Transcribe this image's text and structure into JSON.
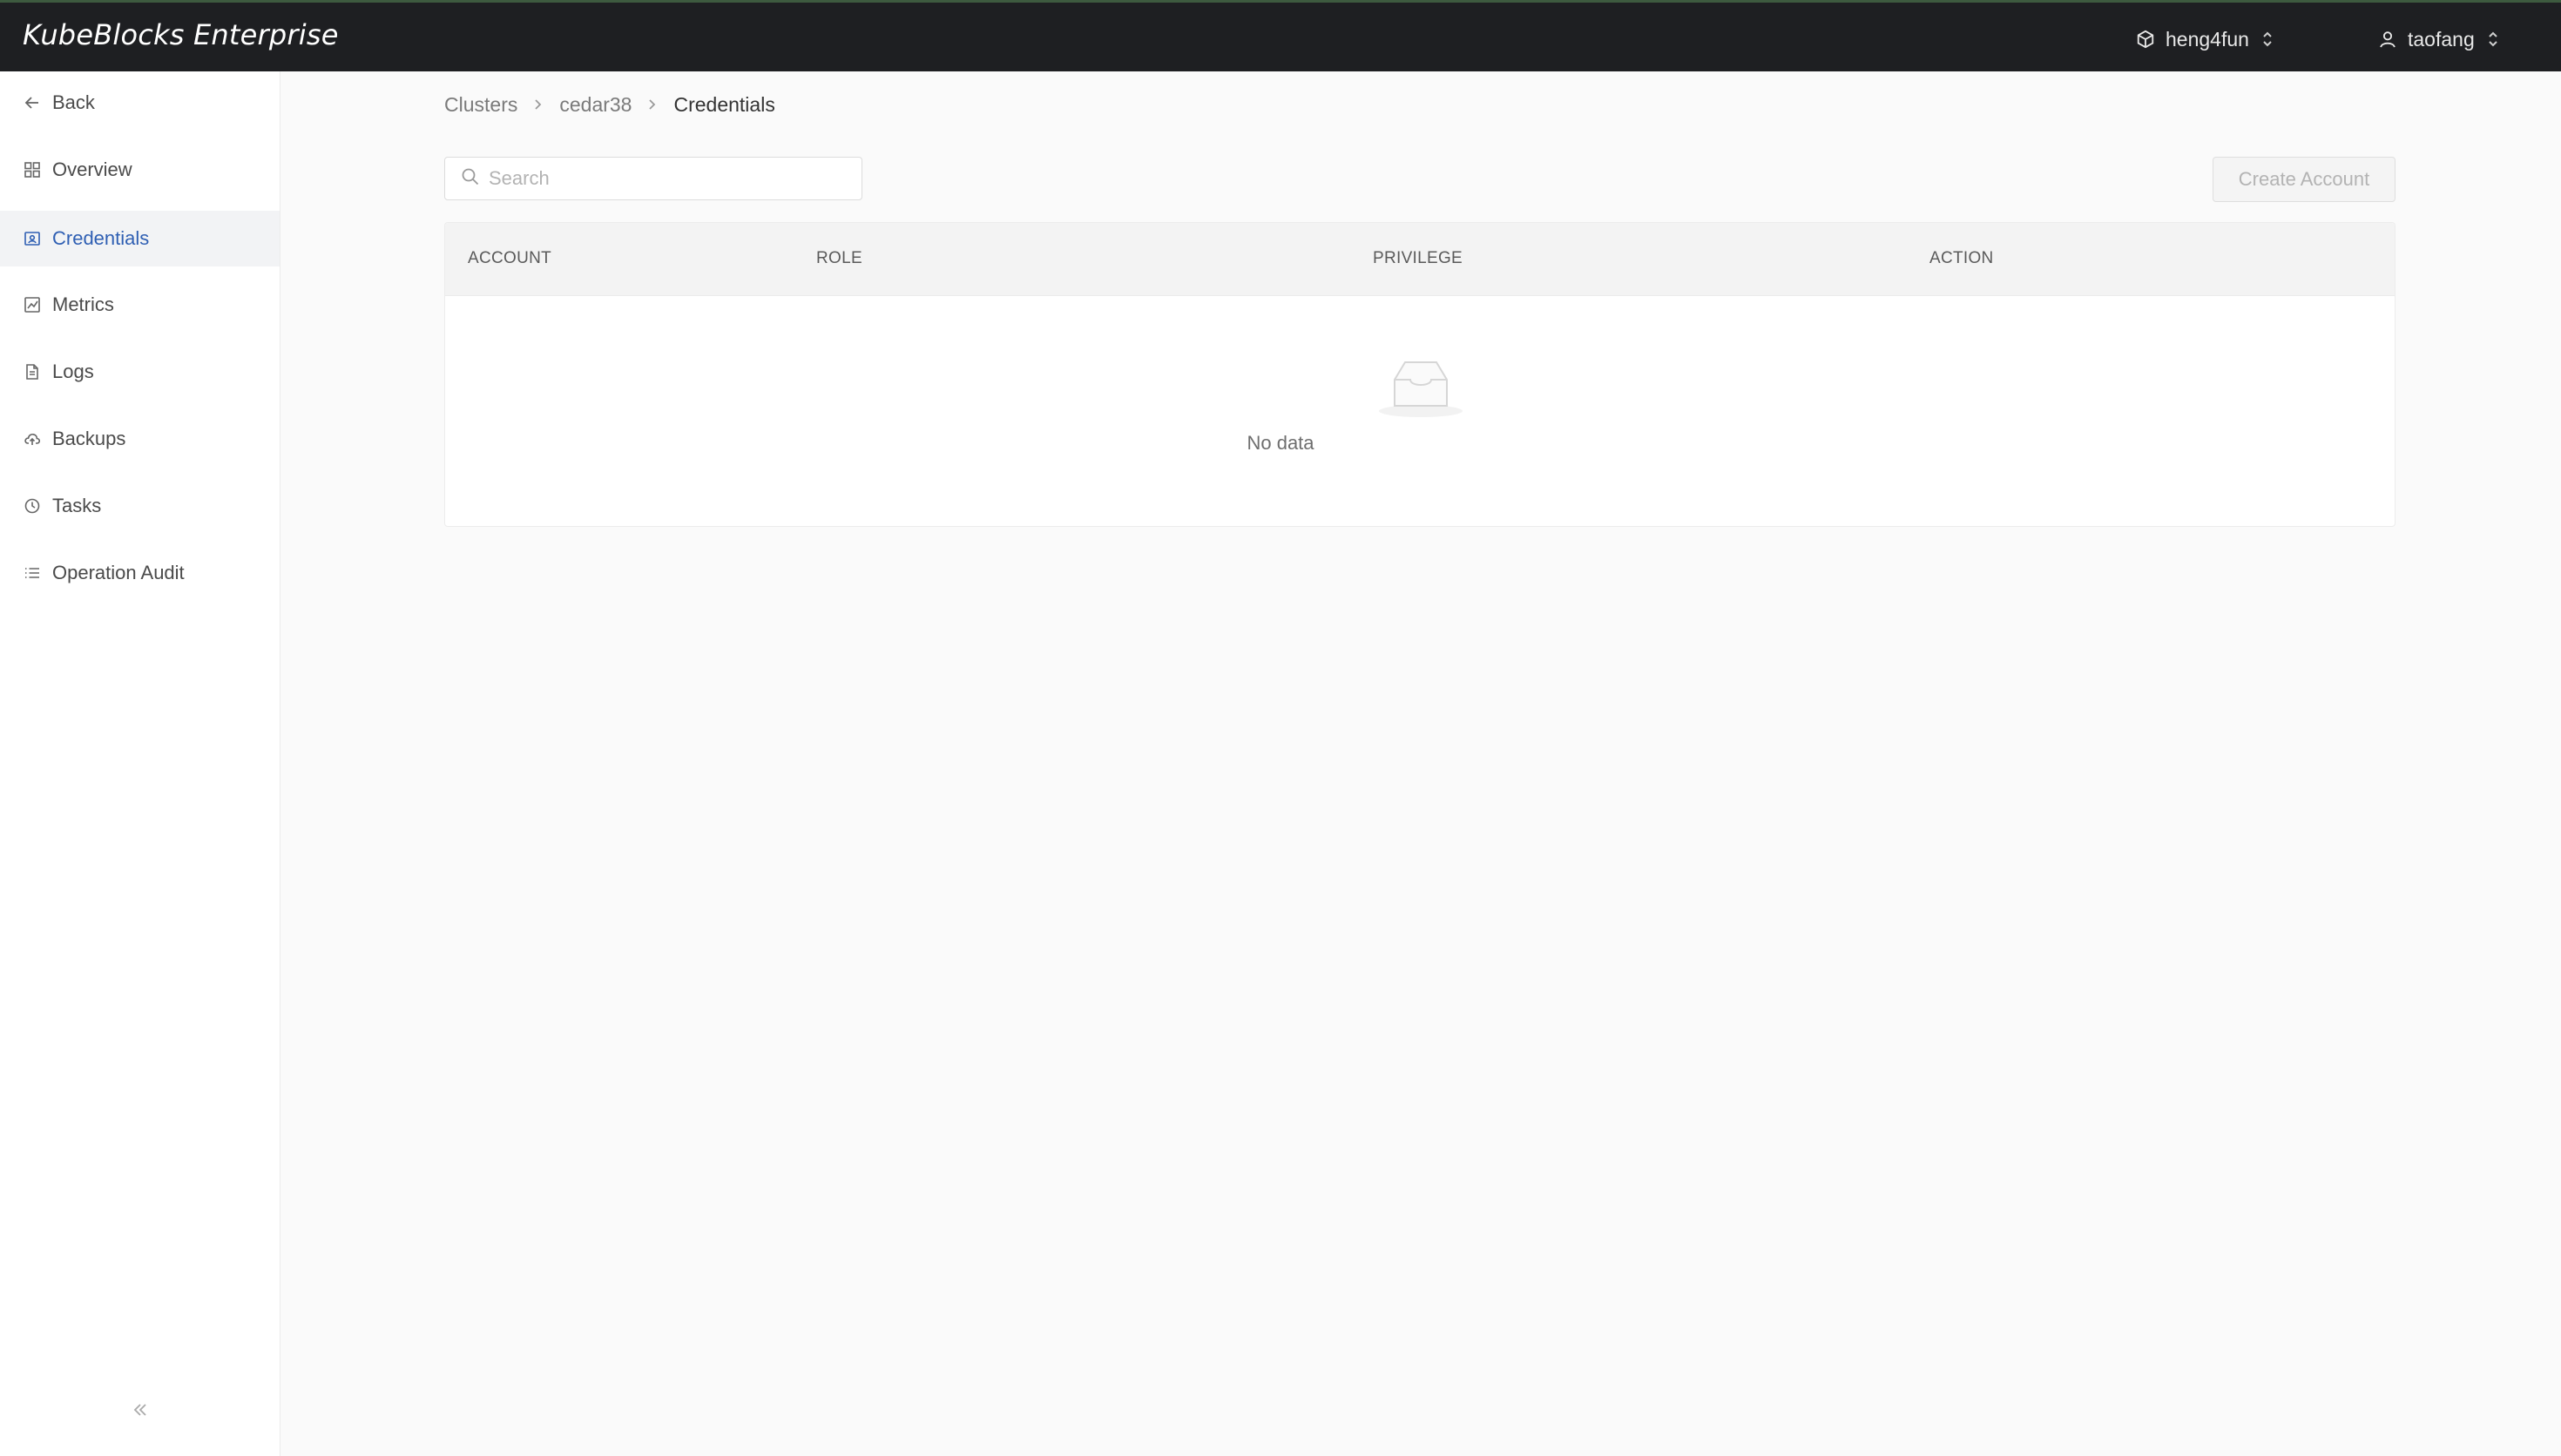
{
  "app": {
    "title": "KubeBlocks Enterprise"
  },
  "header": {
    "org": {
      "label": "heng4fun",
      "icon": "org-cube-icon"
    },
    "user": {
      "label": "taofang",
      "icon": "user-icon"
    }
  },
  "sidebar": {
    "items": [
      {
        "label": "Back",
        "icon": "arrow-left-icon",
        "active": false
      },
      {
        "label": "Overview",
        "icon": "grid-icon",
        "active": false
      },
      {
        "label": "Credentials",
        "icon": "key-card-icon",
        "active": true
      },
      {
        "label": "Metrics",
        "icon": "chart-icon",
        "active": false
      },
      {
        "label": "Logs",
        "icon": "document-icon",
        "active": false
      },
      {
        "label": "Backups",
        "icon": "cloud-upload-icon",
        "active": false
      },
      {
        "label": "Tasks",
        "icon": "clock-icon",
        "active": false
      },
      {
        "label": "Operation Audit",
        "icon": "list-icon",
        "active": false
      }
    ],
    "collapse_icon": "double-chevron-left-icon"
  },
  "breadcrumb": {
    "items": [
      "Clusters",
      "cedar38",
      "Credentials"
    ]
  },
  "search": {
    "placeholder": "Search",
    "value": ""
  },
  "toolbar": {
    "create_label": "Create Account"
  },
  "table": {
    "columns": [
      "ACCOUNT",
      "ROLE",
      "PRIVILEGE",
      "ACTION"
    ],
    "rows": [],
    "empty_text": "No data"
  },
  "colors": {
    "topbar": "#1e1f22",
    "accent": "#2f5fb3",
    "active_bg": "#f2f3f5"
  }
}
